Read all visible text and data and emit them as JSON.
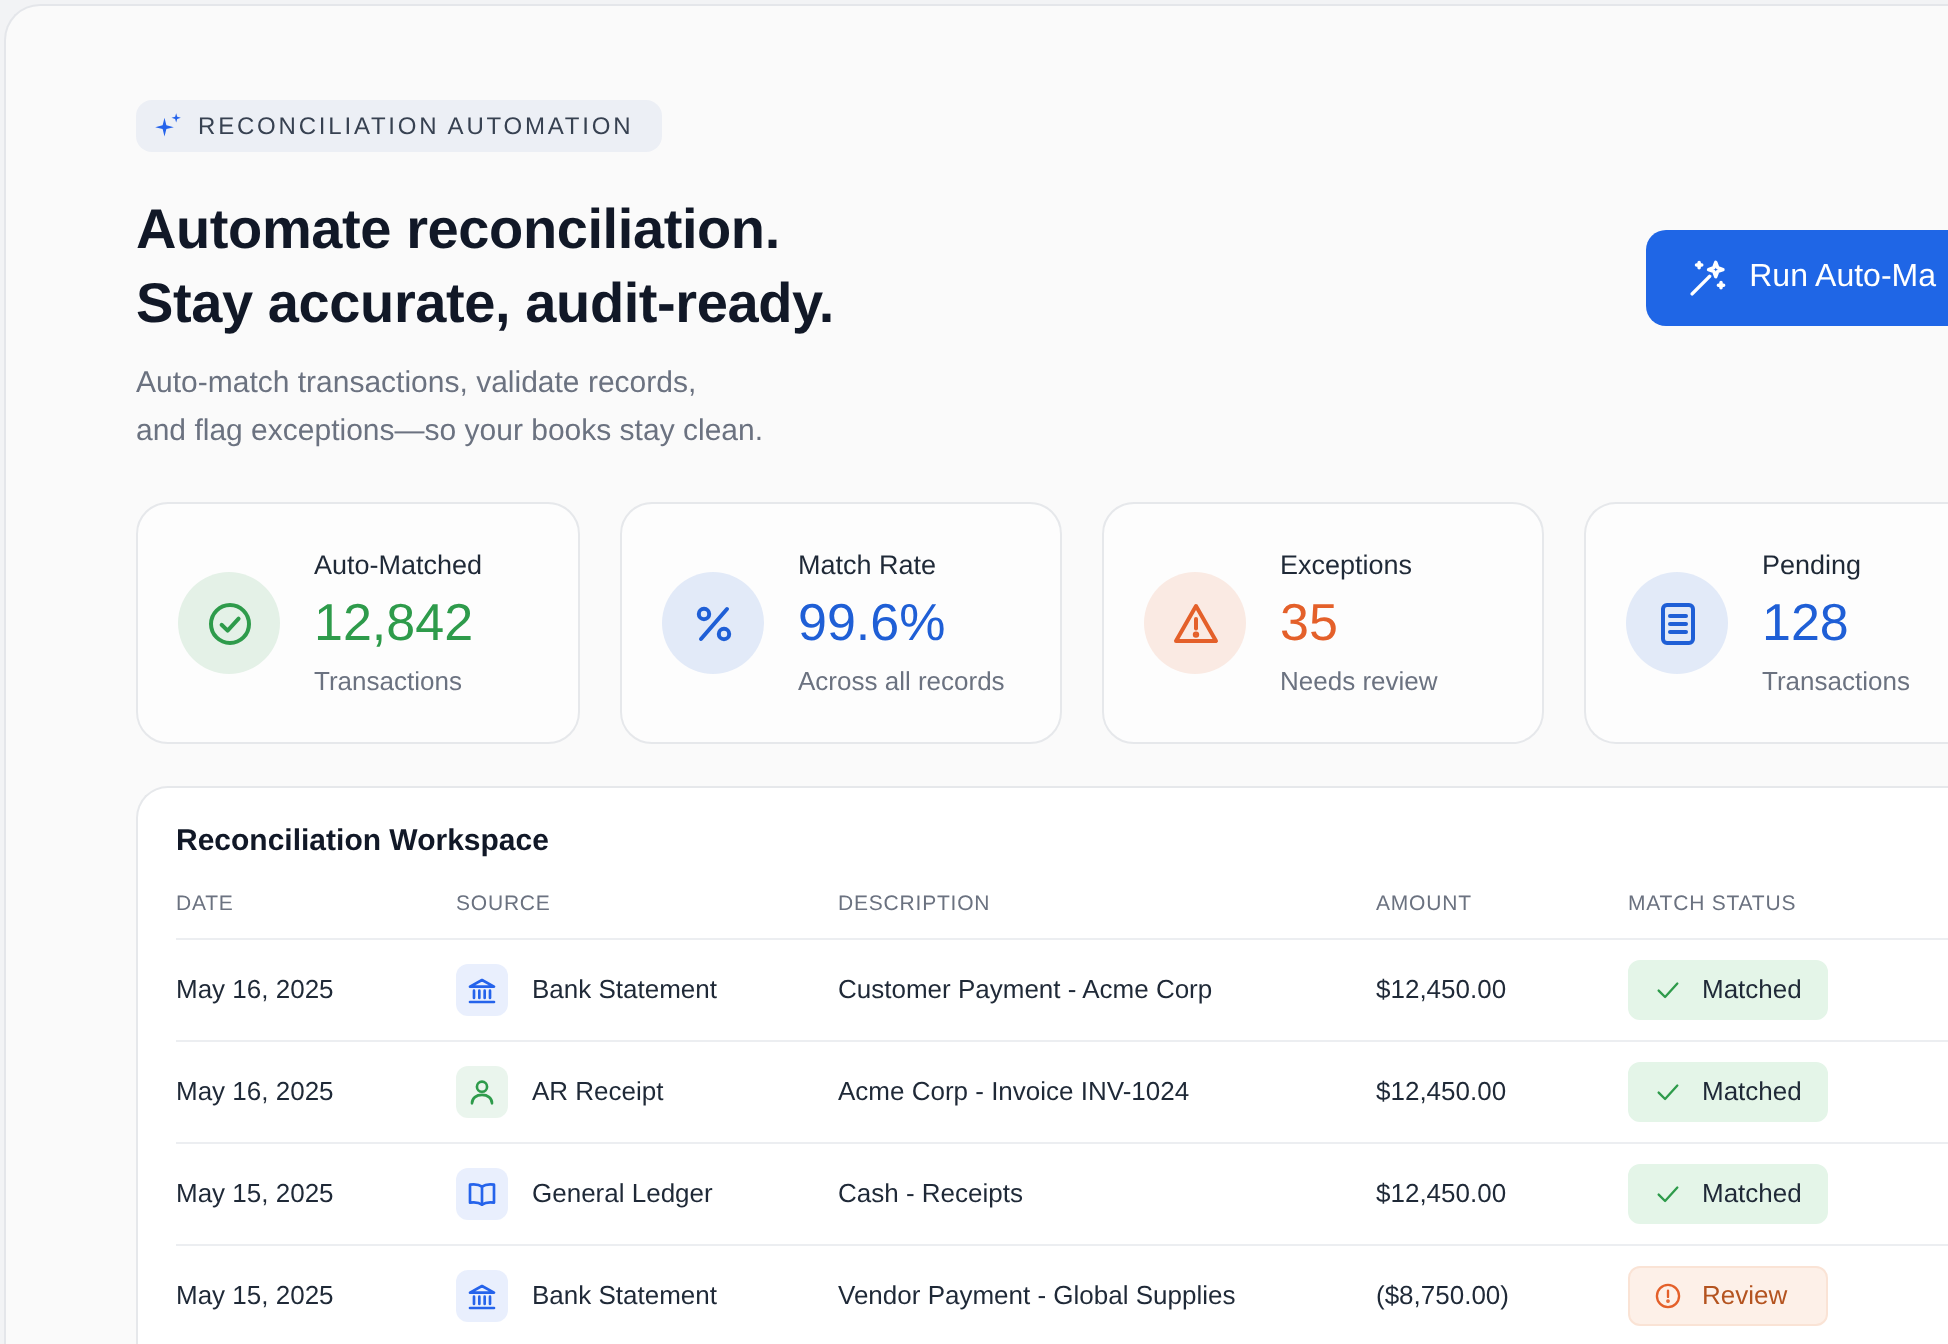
{
  "badge": {
    "label": "RECONCILIATION AUTOMATION"
  },
  "headline": [
    "Automate reconciliation.",
    "Stay accurate, audit-ready."
  ],
  "subtitle": [
    "Auto-match transactions, validate records,",
    "and flag exceptions—so your books stay clean."
  ],
  "primary_button": {
    "label": "Run Auto-Ma"
  },
  "stats": [
    {
      "kind": "check",
      "label": "Auto-Matched",
      "value": "12,842",
      "caption": "Transactions",
      "color": "#2e9b4b"
    },
    {
      "kind": "percent",
      "label": "Match Rate",
      "value": "99.6%",
      "caption": "Across all records",
      "color": "#1f5fd6"
    },
    {
      "kind": "warning",
      "label": "Exceptions",
      "value": "35",
      "caption": "Needs review",
      "color": "#e4602a"
    },
    {
      "kind": "document",
      "label": "Pending",
      "value": "128",
      "caption": "Transactions",
      "color": "#1f5fd6"
    }
  ],
  "table": {
    "title": "Reconciliation Workspace",
    "columns": [
      "DATE",
      "SOURCE",
      "DESCRIPTION",
      "AMOUNT",
      "MATCH STATUS"
    ],
    "rows": [
      {
        "date": "May 16, 2025",
        "source": {
          "kind": "bank",
          "label": "Bank Statement"
        },
        "description": "Customer Payment - Acme Corp",
        "amount": "$12,450.00",
        "status": {
          "kind": "matched",
          "label": "Matched"
        }
      },
      {
        "date": "May 16, 2025",
        "source": {
          "kind": "person",
          "label": "AR Receipt"
        },
        "description": "Acme Corp - Invoice INV-1024",
        "amount": "$12,450.00",
        "status": {
          "kind": "matched",
          "label": "Matched"
        }
      },
      {
        "date": "May 15, 2025",
        "source": {
          "kind": "book",
          "label": "General Ledger"
        },
        "description": "Cash - Receipts",
        "amount": "$12,450.00",
        "status": {
          "kind": "matched",
          "label": "Matched"
        }
      },
      {
        "date": "May 15, 2025",
        "source": {
          "kind": "bank",
          "label": "Bank Statement"
        },
        "description": "Vendor Payment - Global Supplies",
        "amount": "($8,750.00)",
        "status": {
          "kind": "review",
          "label": "Review"
        }
      }
    ]
  }
}
